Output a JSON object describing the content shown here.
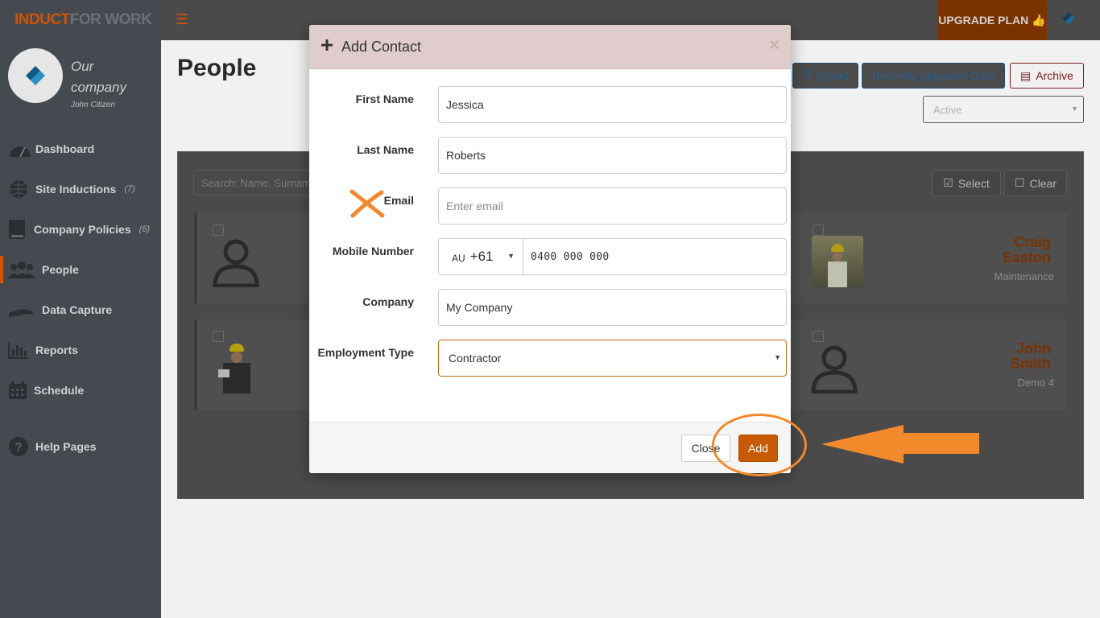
{
  "brand": {
    "part1": "INDUCT",
    "part2": "FOR WORK"
  },
  "profile": {
    "company": "Our company",
    "user": "John Citizen"
  },
  "nav": [
    {
      "label": "Dashboard",
      "icon": "dashboard-gauge-icon",
      "count": ""
    },
    {
      "label": "Site Inductions",
      "icon": "globe-icon",
      "count": "(7)"
    },
    {
      "label": "Company Policies",
      "icon": "book-icon",
      "count": "(6)"
    },
    {
      "label": "People",
      "icon": "people-icon",
      "count": "",
      "active": true
    },
    {
      "label": "Data Capture",
      "icon": "hand-icon",
      "count": ""
    },
    {
      "label": "Reports",
      "icon": "bar-chart-icon",
      "count": ""
    },
    {
      "label": "Schedule",
      "icon": "calendar-icon",
      "count": ""
    },
    {
      "label": "Help Pages",
      "icon": "help-icon",
      "count": ""
    }
  ],
  "topbar": {
    "upgrade_label": "UPGRADE PLAN",
    "upgrade_icon": "thumbs-up-icon"
  },
  "page": {
    "title": "People",
    "import_label": "Import",
    "recent_label": "Recently Uploaded Data",
    "archive_label": "Archive",
    "status_value": "Active",
    "search_placeholder": "Search: Name, Surname...",
    "select_label": "Select",
    "clear_label": "Clear"
  },
  "people": [
    {
      "first": "Craig",
      "last": "Easton",
      "role": "Maintenance"
    },
    {
      "first": "John",
      "last": "Smith",
      "role": "Demo 4"
    }
  ],
  "modal": {
    "title": "Add Contact",
    "first_name_label": "First Name",
    "first_name_value": "Jessica",
    "last_name_label": "Last Name",
    "last_name_value": "Roberts",
    "email_label": "Email",
    "email_placeholder": "Enter email",
    "mobile_label": "Mobile Number",
    "country_code": "AU",
    "dial_code": "+61",
    "mobile_value": "0400 000 000",
    "company_label": "Company",
    "company_value": "My Company",
    "employment_label": "Employment Type",
    "employment_value": "Contractor",
    "close_label": "Close",
    "add_label": "Add"
  },
  "colors": {
    "accent": "#c55a00",
    "annotation": "#f28a2b",
    "overlay": "#4a4a4a"
  }
}
